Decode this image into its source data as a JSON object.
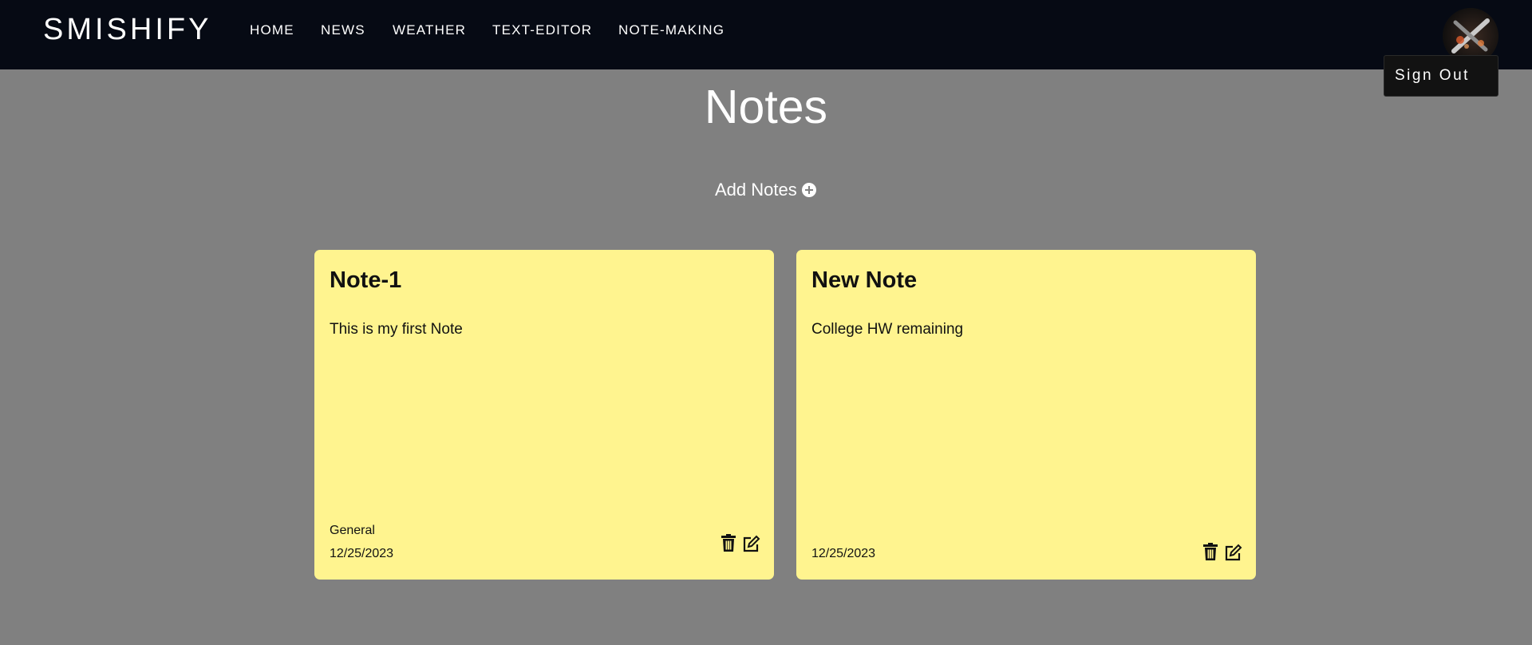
{
  "brand": "SMISHIFY",
  "nav": [
    {
      "label": "HOME"
    },
    {
      "label": "NEWS"
    },
    {
      "label": "WEATHER"
    },
    {
      "label": "TEXT-EDITOR"
    },
    {
      "label": "NOTE-MAKING"
    }
  ],
  "user_menu": {
    "signout_label": "Sign Out",
    "avatar_icon": "avatar-icon"
  },
  "page": {
    "title": "Notes",
    "add_label": "Add Notes",
    "add_icon": "plus-circle-icon"
  },
  "notes": [
    {
      "title": "Note-1",
      "body": "This is my first Note",
      "tag": "General",
      "date": "12/25/2023"
    },
    {
      "title": "New Note",
      "body": "College HW remaining",
      "tag": "",
      "date": "12/25/2023"
    }
  ],
  "icons": {
    "delete": "trash-icon",
    "edit": "edit-icon"
  },
  "colors": {
    "navbar": "#060a14",
    "background": "#808080",
    "note": "#fff48f"
  }
}
